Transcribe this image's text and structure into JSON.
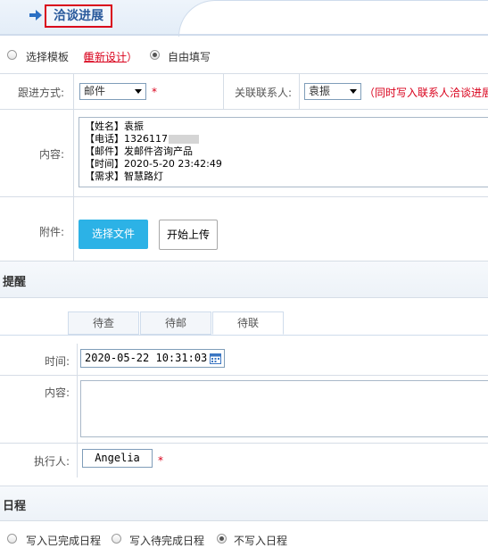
{
  "header": {
    "title": "洽谈进展"
  },
  "mode": {
    "option_template": "选择模板",
    "redesign_open": "（",
    "redesign_link": "重新设计",
    "redesign_close": "）",
    "option_free": "自由填写"
  },
  "form": {
    "follow_label": "跟进方式:",
    "follow_value": "邮件",
    "required_mark": "*",
    "contact_label": "关联联系人:",
    "contact_value": "袁振",
    "contact_note": "（同时写入联系人洽谈进展",
    "content_label": "内容:",
    "content_lines": [
      "【姓名】袁振",
      "【电话】1326117",
      "【邮件】发邮件咨询产品",
      "【时间】2020-5-20 23:42:49",
      "【需求】智慧路灯"
    ],
    "attach_label": "附件:",
    "choose_file": "选择文件",
    "start_upload": "开始上传"
  },
  "reminder": {
    "section_title": "提醒",
    "tabs": [
      "待查",
      "待邮",
      "待联"
    ],
    "time_label": "时间:",
    "time_value": "2020-05-22 10:31:03",
    "content_label": "内容:",
    "executor_label": "执行人:",
    "executor_value": "Angelia",
    "required_mark": "*"
  },
  "schedule": {
    "section_title": "日程",
    "options": [
      "写入已完成日程",
      "写入待完成日程",
      "不写入日程"
    ]
  },
  "colors": {
    "accent_red": "#d9001b",
    "title_blue": "#2a5a9c",
    "button_blue": "#2cb2e6"
  }
}
